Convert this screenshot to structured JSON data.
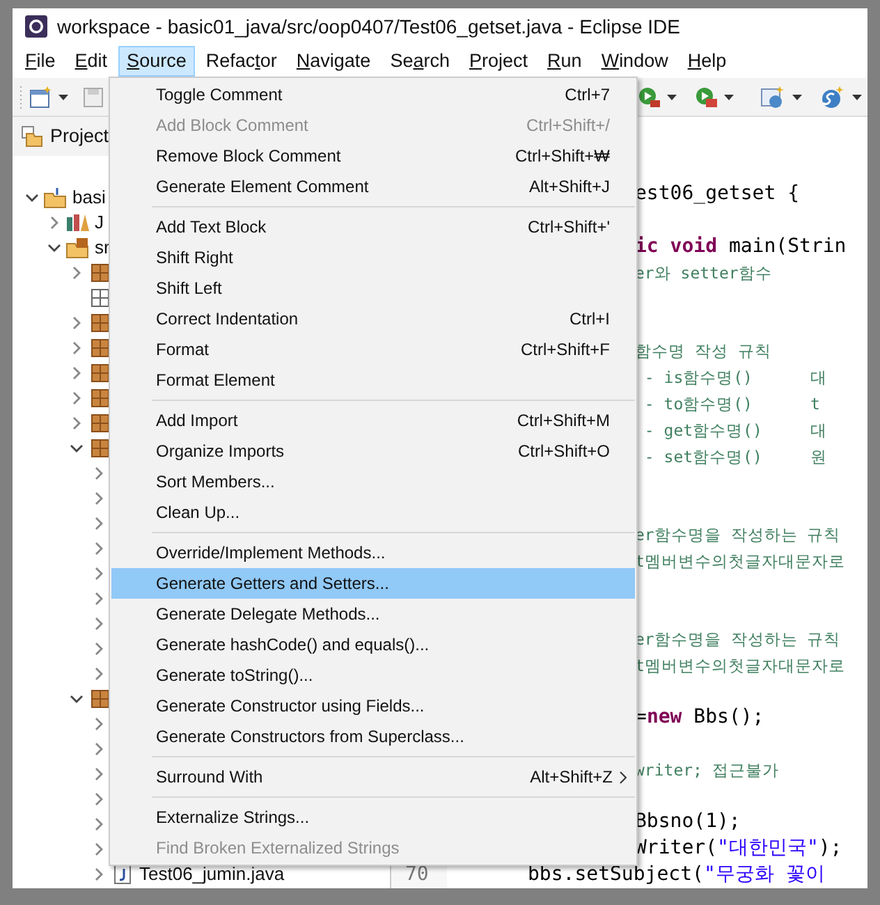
{
  "window": {
    "title": "workspace - basic01_java/src/oop0407/Test06_getset.java - Eclipse IDE"
  },
  "menu_bar": [
    {
      "key": "F",
      "after": "ile",
      "selected": false
    },
    {
      "key": "E",
      "after": "dit",
      "selected": false
    },
    {
      "key": "S",
      "after": "ource",
      "selected": true
    },
    {
      "before": "Refac",
      "key": "t",
      "after": "or",
      "selected": false
    },
    {
      "key": "N",
      "after": "avigate",
      "selected": false
    },
    {
      "before": "Se",
      "key": "a",
      "after": "rch",
      "selected": false
    },
    {
      "key": "P",
      "after": "roject",
      "selected": false
    },
    {
      "key": "R",
      "after": "un",
      "selected": false
    },
    {
      "key": "W",
      "after": "indow",
      "selected": false
    },
    {
      "key": "H",
      "after": "elp",
      "selected": false
    }
  ],
  "project_panel": {
    "title": "Project"
  },
  "tree": [
    {
      "kind": "project",
      "label": "basi",
      "expanded": true,
      "children": [
        {
          "kind": "library",
          "label": "J",
          "expanded": false
        },
        {
          "kind": "source-folder",
          "label": "sr",
          "expanded": true,
          "children": [
            {
              "kind": "package",
              "expanded": false
            },
            {
              "kind": "empty-package"
            },
            {
              "kind": "package",
              "expanded": false
            },
            {
              "kind": "package",
              "expanded": false
            },
            {
              "kind": "package",
              "expanded": false
            },
            {
              "kind": "package",
              "expanded": false
            },
            {
              "kind": "package",
              "expanded": false
            },
            {
              "kind": "package",
              "expanded": true,
              "children": [
                {
                  "expanded": false
                },
                {
                  "expanded": false
                },
                {
                  "expanded": false
                },
                {
                  "expanded": false
                },
                {
                  "expanded": false
                },
                {
                  "expanded": false
                },
                {
                  "expanded": false
                },
                {
                  "expanded": false
                },
                {
                  "expanded": false
                }
              ]
            },
            {
              "kind": "package",
              "expanded": true,
              "children": [
                {
                  "expanded": false
                },
                {
                  "expanded": false
                },
                {
                  "expanded": false
                },
                {
                  "expanded": false
                },
                {
                  "expanded": false
                },
                {
                  "expanded": false
                },
                {
                  "kind": "file",
                  "label": "Test06_jumin.java",
                  "expanded": false
                }
              ]
            }
          ]
        }
      ]
    }
  ],
  "editor": {
    "lines": [
      {
        "segments": [
          {
            "kind": "plain",
            "text": "est06_getset {"
          }
        ]
      },
      {
        "segments": [
          {
            "kind": "keyword",
            "text": "ic void"
          },
          {
            "kind": "plain",
            "text": " main(Strin"
          }
        ]
      },
      {
        "segments": [
          {
            "kind": "comment",
            "text": "er와 setter함수"
          }
        ]
      },
      {
        "segments": [
          {
            "kind": "comment",
            "text": "함수명 작성 규칙"
          }
        ]
      },
      {
        "segments": [
          {
            "kind": "comment",
            "text": " - is함수명()      대"
          }
        ]
      },
      {
        "segments": [
          {
            "kind": "comment",
            "text": " - to함수명()      t"
          }
        ]
      },
      {
        "segments": [
          {
            "kind": "comment",
            "text": " - get함수명()     대"
          }
        ]
      },
      {
        "segments": [
          {
            "kind": "comment",
            "text": " - set함수명()     원"
          }
        ]
      },
      {
        "segments": [
          {
            "kind": "comment",
            "text": "er함수명을 작성하는 규칙"
          }
        ]
      },
      {
        "segments": [
          {
            "kind": "comment",
            "text": "t멤버변수의첫글자대문자로"
          }
        ]
      },
      {
        "segments": [
          {
            "kind": "comment",
            "text": "er함수명을 작성하는 규칙"
          }
        ]
      },
      {
        "segments": [
          {
            "kind": "comment",
            "text": "t멤버변수의첫글자대문자로"
          }
        ]
      },
      {
        "segments": [
          {
            "kind": "plain",
            "text": "="
          },
          {
            "kind": "keyword",
            "text": "new"
          },
          {
            "kind": "plain",
            "text": " Bbs();"
          }
        ]
      },
      {
        "segments": [
          {
            "kind": "comment",
            "text": "writer; 접근불가"
          }
        ]
      },
      {
        "segments": [
          {
            "kind": "plain",
            "text": "Bbsno(1);"
          }
        ]
      },
      {
        "segments": [
          {
            "kind": "plain",
            "text": "Writer("
          },
          {
            "kind": "string",
            "text": "\"대한민국\""
          },
          {
            "kind": "plain",
            "text": ");"
          }
        ]
      }
    ],
    "last_line": {
      "number": "70",
      "segments": [
        {
          "kind": "plain",
          "text": "bbs.setSubject("
        },
        {
          "kind": "string",
          "text": "\"무궁화 꽃이"
        }
      ]
    }
  },
  "source_menu": [
    [
      {
        "label": "Toggle Comment",
        "shortcut": "Ctrl+7",
        "disabled": false,
        "selected": false
      },
      {
        "label": "Add Block Comment",
        "shortcut": "Ctrl+Shift+/",
        "disabled": true,
        "selected": false
      },
      {
        "label": "Remove Block Comment",
        "shortcut": "Ctrl+Shift+₩",
        "disabled": false,
        "selected": false
      },
      {
        "label": "Generate Element Comment",
        "shortcut": "Alt+Shift+J",
        "disabled": false,
        "selected": false
      }
    ],
    [
      {
        "label": "Add Text Block",
        "shortcut": "Ctrl+Shift+'",
        "disabled": false,
        "selected": false
      },
      {
        "label": "Shift Right",
        "disabled": false,
        "selected": false
      },
      {
        "label": "Shift Left",
        "disabled": false,
        "selected": false
      },
      {
        "label": "Correct Indentation",
        "shortcut": "Ctrl+I",
        "disabled": false,
        "selected": false
      },
      {
        "label": "Format",
        "shortcut": "Ctrl+Shift+F",
        "disabled": false,
        "selected": false
      },
      {
        "label": "Format Element",
        "disabled": false,
        "selected": false
      }
    ],
    [
      {
        "label": "Add Import",
        "shortcut": "Ctrl+Shift+M",
        "disabled": false,
        "selected": false
      },
      {
        "label": "Organize Imports",
        "shortcut": "Ctrl+Shift+O",
        "disabled": false,
        "selected": false
      },
      {
        "label": "Sort Members...",
        "disabled": false,
        "selected": false
      },
      {
        "label": "Clean Up...",
        "disabled": false,
        "selected": false
      }
    ],
    [
      {
        "label": "Override/Implement Methods...",
        "disabled": false,
        "selected": false
      },
      {
        "label": "Generate Getters and Setters...",
        "disabled": false,
        "selected": true
      },
      {
        "label": "Generate Delegate Methods...",
        "disabled": false,
        "selected": false
      },
      {
        "label": "Generate hashCode() and equals()...",
        "disabled": false,
        "selected": false
      },
      {
        "label": "Generate toString()...",
        "disabled": false,
        "selected": false
      },
      {
        "label": "Generate Constructor using Fields...",
        "disabled": false,
        "selected": false
      },
      {
        "label": "Generate Constructors from Superclass...",
        "disabled": false,
        "selected": false
      }
    ],
    [
      {
        "label": "Surround With",
        "shortcut": "Alt+Shift+Z",
        "disabled": false,
        "selected": false,
        "submenu": true
      }
    ],
    [
      {
        "label": "Externalize Strings...",
        "disabled": false,
        "selected": false
      },
      {
        "label": "Find Broken Externalized Strings",
        "disabled": true,
        "selected": false
      }
    ]
  ]
}
